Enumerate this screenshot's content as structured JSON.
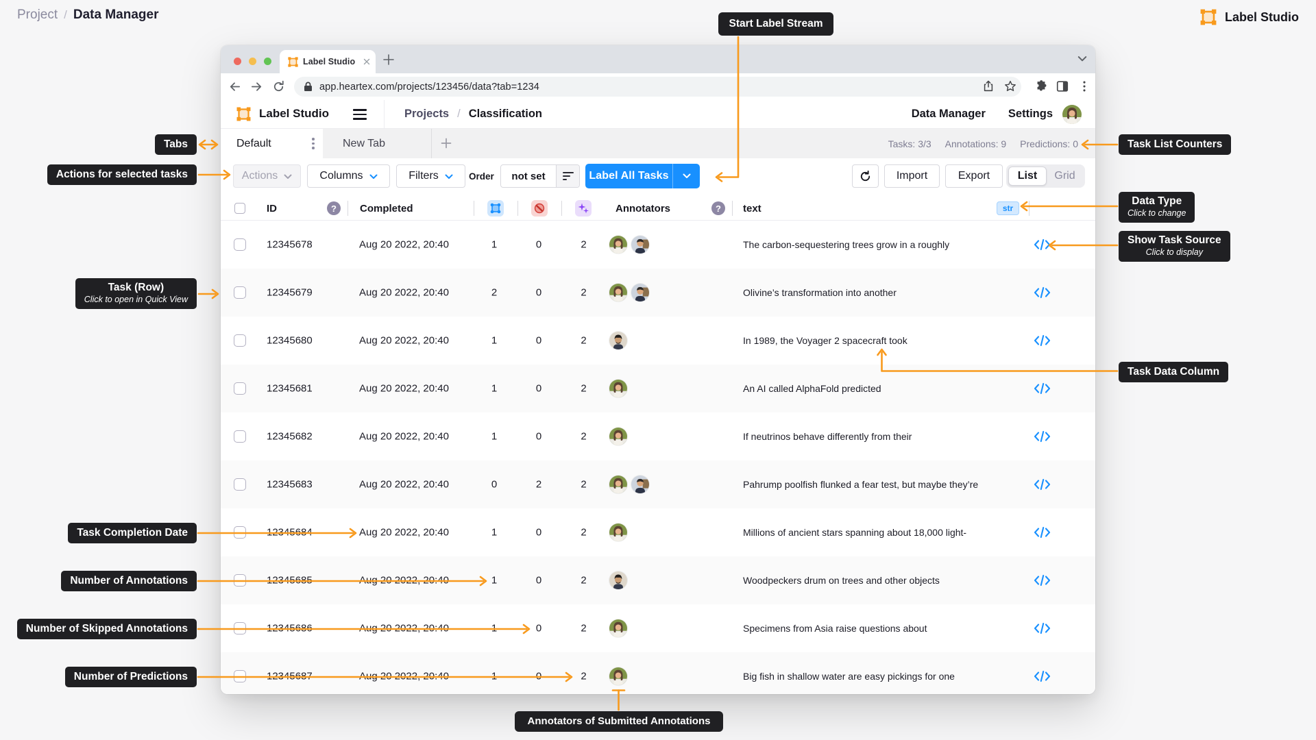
{
  "page": {
    "breadcrumb": {
      "section": "Project",
      "separator": "/",
      "current": "Data Manager"
    },
    "brand": {
      "name": "Label Studio"
    }
  },
  "callouts": {
    "start_label_stream": "Start Label Stream",
    "tabs": "Tabs",
    "actions_for_selected": "Actions for selected tasks",
    "task_row_title": "Task (Row)",
    "task_row_sub": "Click to open in Quick View",
    "completion_date": "Task Completion Date",
    "num_annotations": "Number of Annotations",
    "num_skipped": "Number of Skipped Annotations",
    "num_predictions": "Number of Predictions",
    "task_list_counters": "Task List Counters",
    "data_type_title": "Data Type",
    "data_type_sub": "Click to change",
    "task_source_title": "Show Task Source",
    "task_source_sub": "Click to display",
    "task_data_column": "Task Data Column",
    "annotators_submitted": "Annotators of Submitted Annotations"
  },
  "browser_chrome": {
    "tab_title": "Label Studio",
    "url": "app.heartex.com/projects/123456/data?tab=1234"
  },
  "app_header": {
    "logo_text": "Label Studio",
    "breadcrumb": {
      "parent": "Projects",
      "separator": "/",
      "current": "Classification"
    },
    "nav": {
      "data_manager": "Data Manager",
      "settings": "Settings"
    }
  },
  "dm_tabs": {
    "active_tab": "Default",
    "new_tab": "New Tab",
    "counters": [
      "Tasks: 3/3",
      "Annotations: 9",
      "Predictions: 0"
    ]
  },
  "toolbar": {
    "actions": "Actions",
    "columns": "Columns",
    "filters": "Filters",
    "order_label": "Order",
    "order_value": "not set",
    "label_all_tasks": "Label All Tasks",
    "import": "Import",
    "export": "Export",
    "view_list": "List",
    "view_grid": "Grid"
  },
  "table": {
    "header": {
      "id": "ID",
      "completed": "Completed",
      "annotators": "Annotators",
      "text": "text",
      "type_badge": "str"
    },
    "rows": [
      {
        "id": "12345678",
        "completed": "Aug 20 2022, 20:40",
        "annotations": "1",
        "skipped": "0",
        "predictions": "2",
        "annotators": [
          "woman",
          "man-glasses"
        ],
        "text": "The carbon-sequestering trees grow in a roughly"
      },
      {
        "id": "12345679",
        "completed": "Aug 20 2022, 20:40",
        "annotations": "2",
        "skipped": "0",
        "predictions": "2",
        "annotators": [
          "woman",
          "man-glasses"
        ],
        "text": "Olivine’s transformation into another"
      },
      {
        "id": "12345680",
        "completed": "Aug 20 2022, 20:40",
        "annotations": "1",
        "skipped": "0",
        "predictions": "2",
        "annotators": [
          "man-beard"
        ],
        "text": "In 1989, the Voyager 2 spacecraft took"
      },
      {
        "id": "12345681",
        "completed": "Aug 20 2022, 20:40",
        "annotations": "1",
        "skipped": "0",
        "predictions": "2",
        "annotators": [
          "woman"
        ],
        "text": "An AI called AlphaFold predicted"
      },
      {
        "id": "12345682",
        "completed": "Aug 20 2022, 20:40",
        "annotations": "1",
        "skipped": "0",
        "predictions": "2",
        "annotators": [
          "woman"
        ],
        "text": "If neutrinos behave differently from their"
      },
      {
        "id": "12345683",
        "completed": "Aug 20 2022, 20:40",
        "annotations": "0",
        "skipped": "2",
        "predictions": "2",
        "annotators": [
          "woman",
          "man-glasses"
        ],
        "text": "Pahrump poolfish flunked a fear test, but maybe they’re"
      },
      {
        "id": "12345684",
        "completed": "Aug 20 2022, 20:40",
        "annotations": "1",
        "skipped": "0",
        "predictions": "2",
        "annotators": [
          "woman"
        ],
        "text": "Millions of ancient stars spanning about 18,000 light-"
      },
      {
        "id": "12345685",
        "completed": "Aug 20 2022, 20:40",
        "annotations": "1",
        "skipped": "0",
        "predictions": "2",
        "annotators": [
          "man-beard"
        ],
        "text": "Woodpeckers drum on trees and other objects"
      },
      {
        "id": "12345686",
        "completed": "Aug 20 2022, 20:40",
        "annotations": "1",
        "skipped": "0",
        "predictions": "2",
        "annotators": [
          "woman"
        ],
        "text": "Specimens from Asia raise questions about"
      },
      {
        "id": "12345687",
        "completed": "Aug 20 2022, 20:40",
        "annotations": "1",
        "skipped": "0",
        "predictions": "2",
        "annotators": [
          "woman"
        ],
        "text": "Big fish in shallow water are easy pickings for one"
      }
    ]
  },
  "icons": {
    "annotations_column": "bounding-box-icon",
    "skipped_column": "cancel-icon",
    "predictions_column": "sparkles-icon",
    "task_source": "code-icon",
    "help": "question-mark-icon"
  },
  "colors": {
    "accent_orange": "#f89a1d",
    "primary_blue": "#1890ff",
    "callout_bg": "#202023",
    "row_alt": "#fafafa"
  }
}
